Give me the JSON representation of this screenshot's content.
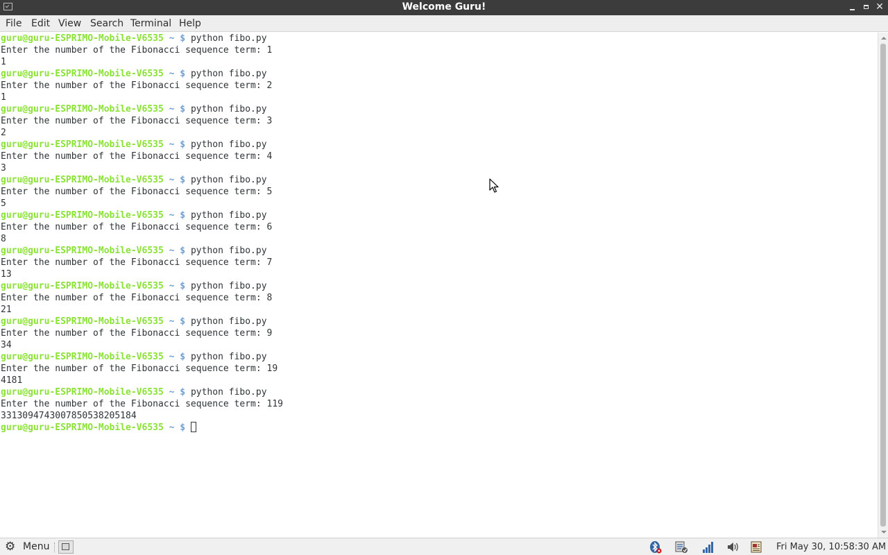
{
  "window": {
    "title": "Welcome Guru!"
  },
  "menubar": {
    "items": [
      "File",
      "Edit",
      "View",
      "Search",
      "Terminal",
      "Help"
    ]
  },
  "terminal": {
    "prompt": {
      "user": "guru@guru-ESPRIMO-Mobile-V6535",
      "dir": "~",
      "symbol": "$"
    },
    "lines": [
      {
        "t": "prompt",
        "cmd": "python fibo.py"
      },
      {
        "t": "out",
        "text": "Enter the number of the Fibonacci sequence term: 1"
      },
      {
        "t": "out",
        "text": "1"
      },
      {
        "t": "prompt",
        "cmd": "python fibo.py"
      },
      {
        "t": "out",
        "text": "Enter the number of the Fibonacci sequence term: 2"
      },
      {
        "t": "out",
        "text": "1"
      },
      {
        "t": "prompt",
        "cmd": "python fibo.py"
      },
      {
        "t": "out",
        "text": "Enter the number of the Fibonacci sequence term: 3"
      },
      {
        "t": "out",
        "text": "2"
      },
      {
        "t": "prompt",
        "cmd": "python fibo.py"
      },
      {
        "t": "out",
        "text": "Enter the number of the Fibonacci sequence term: 4"
      },
      {
        "t": "out",
        "text": "3"
      },
      {
        "t": "prompt",
        "cmd": "python fibo.py"
      },
      {
        "t": "out",
        "text": "Enter the number of the Fibonacci sequence term: 5"
      },
      {
        "t": "out",
        "text": "5"
      },
      {
        "t": "prompt",
        "cmd": "python fibo.py"
      },
      {
        "t": "out",
        "text": "Enter the number of the Fibonacci sequence term: 6"
      },
      {
        "t": "out",
        "text": "8"
      },
      {
        "t": "prompt",
        "cmd": "python fibo.py"
      },
      {
        "t": "out",
        "text": "Enter the number of the Fibonacci sequence term: 7"
      },
      {
        "t": "out",
        "text": "13"
      },
      {
        "t": "prompt",
        "cmd": "python fibo.py"
      },
      {
        "t": "out",
        "text": "Enter the number of the Fibonacci sequence term: 8"
      },
      {
        "t": "out",
        "text": "21"
      },
      {
        "t": "prompt",
        "cmd": "python fibo.py"
      },
      {
        "t": "out",
        "text": "Enter the number of the Fibonacci sequence term: 9"
      },
      {
        "t": "out",
        "text": "34"
      },
      {
        "t": "prompt",
        "cmd": "python fibo.py"
      },
      {
        "t": "out",
        "text": "Enter the number of the Fibonacci sequence term: 19"
      },
      {
        "t": "out",
        "text": "4181"
      },
      {
        "t": "prompt",
        "cmd": "python fibo.py"
      },
      {
        "t": "out",
        "text": "Enter the number of the Fibonacci sequence term: 119"
      },
      {
        "t": "out",
        "text": "3313094743007850538205184"
      },
      {
        "t": "prompt",
        "cmd": "",
        "cursor": true
      }
    ]
  },
  "taskbar": {
    "menu_label": "Menu",
    "clock": "Fri May 30, 10:58:30 AM",
    "tray_icons": [
      "bluetooth-icon",
      "update-manager-icon",
      "network-icon",
      "volume-icon",
      "notes-icon"
    ]
  },
  "colors": {
    "prompt_user": "#8ae234",
    "prompt_dir": "#729fcf",
    "text": "#2e3436",
    "titlebar": "#3c3c3c"
  }
}
